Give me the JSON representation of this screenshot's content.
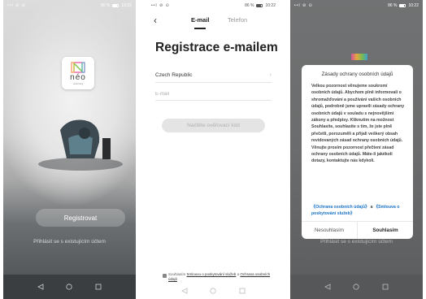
{
  "status": {
    "left": "••l ⊘ ⊙",
    "battery_text": "86 %",
    "time": "10:22"
  },
  "welcome": {
    "logo_text": "néo",
    "logo_sub": "smart living",
    "register_label": "Registrovat",
    "login_label": "Přihlásit se s existujícím účtem"
  },
  "register_email": {
    "tab_email": "E-mail",
    "tab_phone": "Telefon",
    "title": "Registrace e-mailem",
    "country": "Czech Republic",
    "email_placeholder": "E-mail",
    "get_code_label": "Načtěte ověřovací kód",
    "consent_prefix": "Souhlasím ",
    "consent_terms": "Smlouvu o poskytování služeb",
    "consent_and": " a ",
    "consent_privacy": "Ochrana osobních údajů"
  },
  "privacy_modal": {
    "title": "Zásady ochrany osobních údajů",
    "body": "Velkou pozornost věnujeme soukromí osobních údajů. Abychom plně informovali o shromažďování a používání vašich osobních údajů, podrobně jsme upravili zásady ochrany osobních údajů v souladu s nejnovějšími zákony a předpisy. Kliknutím na možnost Souhlasíte, souhlasíte s tím, že jste plně přečetli, porozuměli a přijali veškerý obsah revidovaných zásad ochrany osobních údajů. Věnujte prosím pozornost přečtení zásad ochrany osobních údajů. Máte-li jakékoli dotazy, kontaktujte nás kdykoli.",
    "link_privacy": "《Ochrana osobních údajů》",
    "link_sep": " a ",
    "link_terms": "《Smlouva o poskytování služeb》",
    "decline_label": "Nesouhlasím",
    "accept_label": "Souhlasím",
    "login_peek": "Přihlásit se s existujícím účtem"
  }
}
